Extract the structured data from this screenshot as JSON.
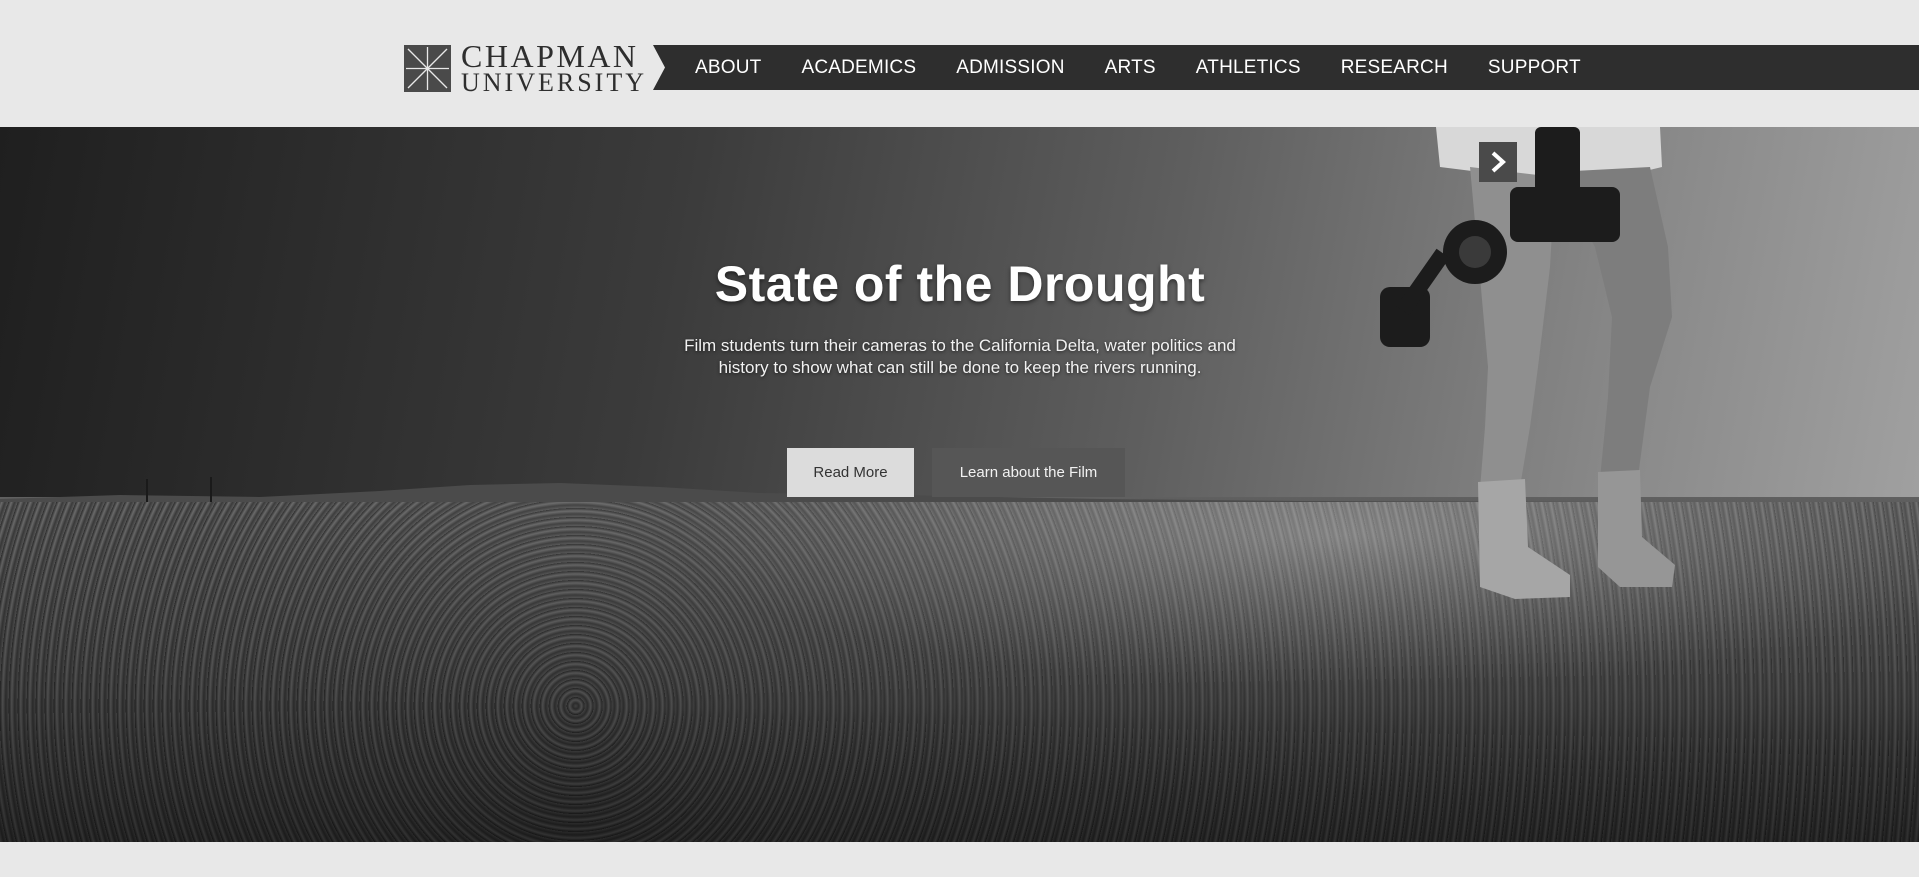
{
  "header": {
    "logo": {
      "line1": "CHAPMAN",
      "line2": "UNIVERSITY",
      "icon": "chapman-logo-mark-icon"
    },
    "nav": [
      {
        "label": "ABOUT"
      },
      {
        "label": "ACADEMICS"
      },
      {
        "label": "ADMISSION"
      },
      {
        "label": "ARTS"
      },
      {
        "label": "ATHLETICS"
      },
      {
        "label": "RESEARCH"
      },
      {
        "label": "SUPPORT"
      }
    ]
  },
  "hero": {
    "title": "State of the Drought",
    "description": "Film students turn their cameras to the California Delta, water politics and history to show what can still be done to keep the rivers running.",
    "primary_button": "Read More",
    "secondary_button": "Learn about the Film",
    "next_icon": "chevron-right-icon"
  },
  "colors": {
    "page_bg": "#e8e8e8",
    "nav_bg": "#2e2e2e",
    "primary_button_bg": "#dcdcdc",
    "secondary_button_bg": "#565656"
  }
}
